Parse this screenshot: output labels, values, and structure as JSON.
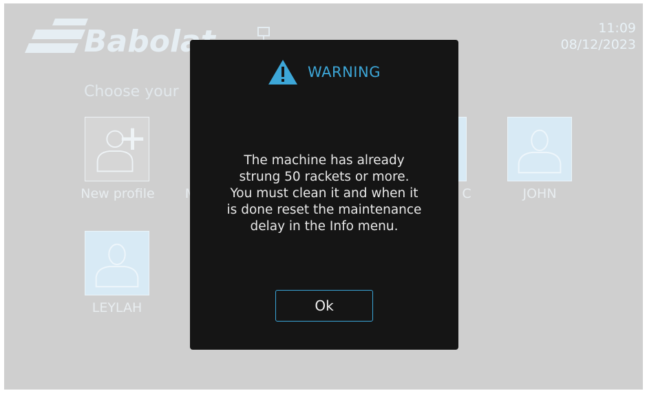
{
  "header": {
    "logo_text": "Babolat",
    "icons": [
      "babolat-logo",
      "network-icon"
    ],
    "clock": {
      "time": "11:09",
      "date": "08/12/2023"
    }
  },
  "profile_screen": {
    "heading": "Choose your",
    "profiles": [
      {
        "label": "New profile",
        "icon": "add-user-icon"
      },
      {
        "label": "M",
        "icon": "user-icon"
      },
      {
        "label": "C",
        "icon": "user-icon"
      },
      {
        "label": "JOHN",
        "icon": "user-icon"
      },
      {
        "label": "LEYLAH",
        "icon": "user-icon"
      }
    ]
  },
  "dialog": {
    "icon": "warning-icon",
    "title": "WARNING",
    "message": "The machine has already\nstrung 50 rackets or more.\nYou must clean it and when it\nis done reset the maintenance\ndelay in the Info menu.",
    "ok_label": "Ok"
  },
  "colors": {
    "background": "#cfcfcf",
    "dialog_bg": "#151515",
    "accent": "#3da7d8",
    "tile_fill": "#d8eaf5"
  }
}
